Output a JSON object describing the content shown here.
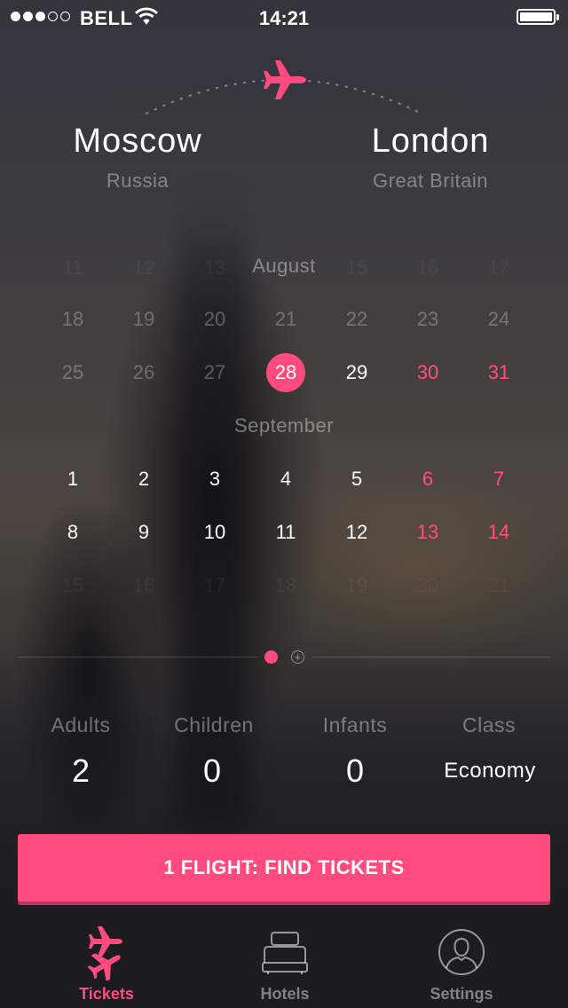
{
  "status_bar": {
    "carrier": "BELL",
    "time": "14:21",
    "signal_bars": 3,
    "signal_total": 5
  },
  "route": {
    "from": {
      "city": "Moscow",
      "country": "Russia"
    },
    "to": {
      "city": "London",
      "country": "Great Britain"
    },
    "icon": "plane-icon"
  },
  "calendar": {
    "months": [
      {
        "name": "August",
        "rows": [
          [
            "11",
            "12",
            "13",
            "14",
            "15",
            "16",
            "17"
          ],
          [
            "18",
            "19",
            "20",
            "21",
            "22",
            "23",
            "24"
          ],
          [
            "25",
            "26",
            "27",
            "28",
            "29",
            "30",
            "31"
          ]
        ]
      },
      {
        "name": "September",
        "rows": [
          [
            "1",
            "2",
            "3",
            "4",
            "5",
            "6",
            "7"
          ],
          [
            "8",
            "9",
            "10",
            "11",
            "12",
            "13",
            "14"
          ],
          [
            "15",
            "16",
            "17",
            "18",
            "19",
            "20",
            "21"
          ]
        ]
      }
    ],
    "selected": "August 28",
    "accent_color": "#ff4b7e"
  },
  "pager": {
    "pages": 1,
    "active": 1,
    "add_icon": "plus-icon"
  },
  "passengers": {
    "adults": {
      "label": "Adults",
      "value": "2"
    },
    "children": {
      "label": "Children",
      "value": "0"
    },
    "infants": {
      "label": "Infants",
      "value": "0"
    },
    "class": {
      "label": "Class",
      "value": "Economy"
    }
  },
  "cta": {
    "label": "1 FLIGHT: FIND TICKETS",
    "color": "#ff4b7e"
  },
  "tabs": [
    {
      "label": "Tickets",
      "icon": "tickets-planes-icon",
      "active": true
    },
    {
      "label": "Hotels",
      "icon": "bed-icon",
      "active": false
    },
    {
      "label": "Settings",
      "icon": "user-icon",
      "active": false
    }
  ]
}
